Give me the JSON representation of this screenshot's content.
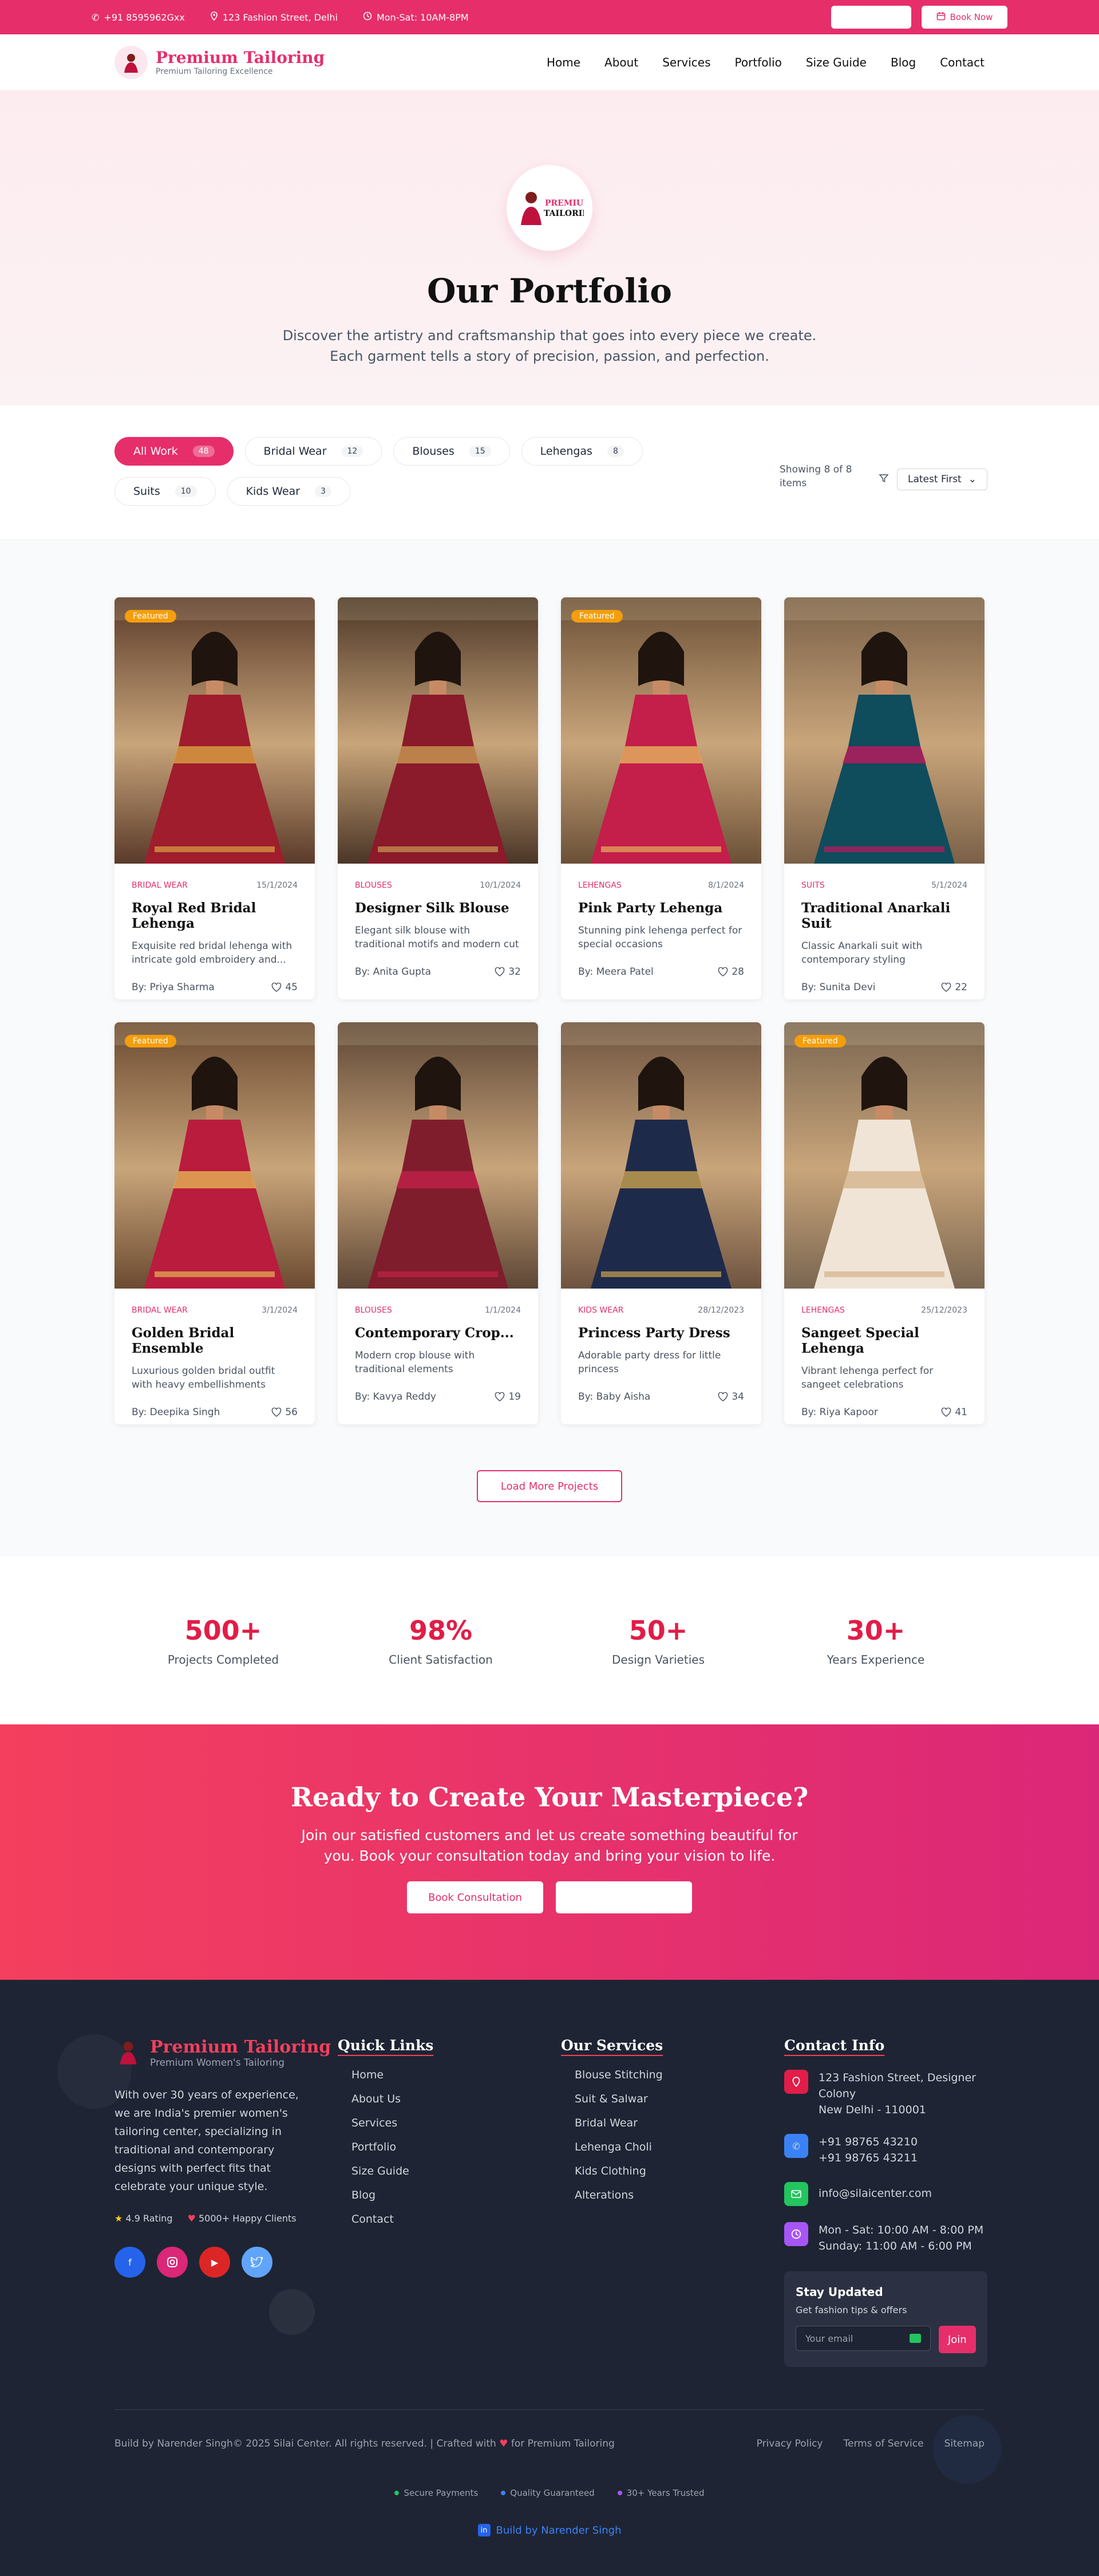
{
  "topbar": {
    "phone": "+91 8595962Gxx",
    "address": "123 Fashion Street, Delhi",
    "hours": "Mon-Sat: 10AM-8PM",
    "button_blank": "",
    "book_now": "Book Now"
  },
  "header": {
    "brand": "Premium Tailoring",
    "tagline": "Premium Tailoring Excellence",
    "nav": [
      "Home",
      "About",
      "Services",
      "Portfolio",
      "Size Guide",
      "Blog",
      "Contact"
    ]
  },
  "hero": {
    "logo_text_1": "PREMIUM",
    "logo_text_2": "TAILORING",
    "title": "Our Portfolio",
    "line1": "Discover the artistry and craftsmanship that goes into every piece we create.",
    "line2": "Each garment tells a story of precision, passion, and perfection."
  },
  "filters": {
    "chips": [
      {
        "label": "All Work",
        "count": "48"
      },
      {
        "label": "Bridal Wear",
        "count": "12"
      },
      {
        "label": "Blouses",
        "count": "15"
      },
      {
        "label": "Lehengas",
        "count": "8"
      },
      {
        "label": "Suits",
        "count": "10"
      },
      {
        "label": "Kids Wear",
        "count": "3"
      }
    ],
    "showing": "Showing 8 of 8 items",
    "sort": "Latest First"
  },
  "portfolio": [
    {
      "category": "BRIDAL WEAR",
      "date": "15/1/2024",
      "title": "Royal Red Bridal Lehenga",
      "desc": "Exquisite red bridal lehenga with intricate gold embroidery and...",
      "by": "By: Priya Sharma",
      "likes": "45",
      "featured": "Featured"
    },
    {
      "category": "BLOUSES",
      "date": "10/1/2024",
      "title": "Designer Silk Blouse",
      "desc": "Elegant silk blouse with traditional motifs and modern cut",
      "by": "By: Anita Gupta",
      "likes": "32",
      "featured": ""
    },
    {
      "category": "LEHENGAS",
      "date": "8/1/2024",
      "title": "Pink Party Lehenga",
      "desc": "Stunning pink lehenga perfect for special occasions",
      "by": "By: Meera Patel",
      "likes": "28",
      "featured": "Featured"
    },
    {
      "category": "SUITS",
      "date": "5/1/2024",
      "title": "Traditional Anarkali Suit",
      "desc": "Classic Anarkali suit with contemporary styling",
      "by": "By: Sunita Devi",
      "likes": "22",
      "featured": ""
    },
    {
      "category": "BRIDAL WEAR",
      "date": "3/1/2024",
      "title": "Golden Bridal Ensemble",
      "desc": "Luxurious golden bridal outfit with heavy embellishments",
      "by": "By: Deepika Singh",
      "likes": "56",
      "featured": "Featured"
    },
    {
      "category": "BLOUSES",
      "date": "1/1/2024",
      "title": "Contemporary Crop...",
      "desc": "Modern crop blouse with traditional elements",
      "by": "By: Kavya Reddy",
      "likes": "19",
      "featured": ""
    },
    {
      "category": "KIDS WEAR",
      "date": "28/12/2023",
      "title": "Princess Party Dress",
      "desc": "Adorable party dress for little princess",
      "by": "By: Baby Aisha",
      "likes": "34",
      "featured": ""
    },
    {
      "category": "LEHENGAS",
      "date": "25/12/2023",
      "title": "Sangeet Special Lehenga",
      "desc": "Vibrant lehenga perfect for sangeet celebrations",
      "by": "By: Riya Kapoor",
      "likes": "41",
      "featured": "Featured"
    }
  ],
  "load_more": "Load More Projects",
  "stats": [
    {
      "num": "500+",
      "label": "Projects Completed"
    },
    {
      "num": "98%",
      "label": "Client Satisfaction"
    },
    {
      "num": "50+",
      "label": "Design Varieties"
    },
    {
      "num": "30+",
      "label": "Years Experience"
    }
  ],
  "cta": {
    "title": "Ready to Create Your Masterpiece?",
    "line1": "Join our satisfied customers and let us create something beautiful for",
    "line2": "you. Book your consultation today and bring your vision to life.",
    "book": "Book Consultation",
    "blank": ""
  },
  "footer": {
    "brand": "Premium Tailoring",
    "brand_sub": "Premium Women's Tailoring",
    "about": "With over 30 years of experience, we are India's premier women's tailoring center, specializing in traditional and contemporary designs with perfect fits that celebrate your unique style.",
    "rating": "4.9 Rating",
    "clients": "5000+ Happy Clients",
    "quick_links_title": "Quick Links",
    "quick_links": [
      "Home",
      "About Us",
      "Services",
      "Portfolio",
      "Size Guide",
      "Blog",
      "Contact"
    ],
    "services_title": "Our Services",
    "services": [
      "Blouse Stitching",
      "Suit & Salwar",
      "Bridal Wear",
      "Lehenga Choli",
      "Kids Clothing",
      "Alterations"
    ],
    "contact_title": "Contact Info",
    "address1": "123 Fashion Street, Designer Colony",
    "address2": "New Delhi - 110001",
    "phone1": "+91 98765 43210",
    "phone2": "+91 98765 43211",
    "email": "info@silaicenter.com",
    "hours1": "Mon - Sat: 10:00 AM - 8:00 PM",
    "hours2": "Sunday: 11:00 AM - 6:00 PM",
    "newsletter_title": "Stay Updated",
    "newsletter_sub": "Get fashion tips & offers",
    "newsletter_placeholder": "Your email",
    "join": "Join",
    "copyright": "Build by Narender Singh© 2025 Silai Center. All rights reserved. | Crafted with",
    "copyright_end": "for Premium Tailoring",
    "legal": [
      "Privacy Policy",
      "Terms of Service",
      "Sitemap"
    ],
    "trust": [
      "Secure Payments",
      "Quality Guaranteed",
      "30+ Years Trusted"
    ],
    "built_by": "Build by Narender Singh"
  },
  "colors": {
    "accent": "#e62e6b",
    "footer_bg": "#1e2433"
  }
}
